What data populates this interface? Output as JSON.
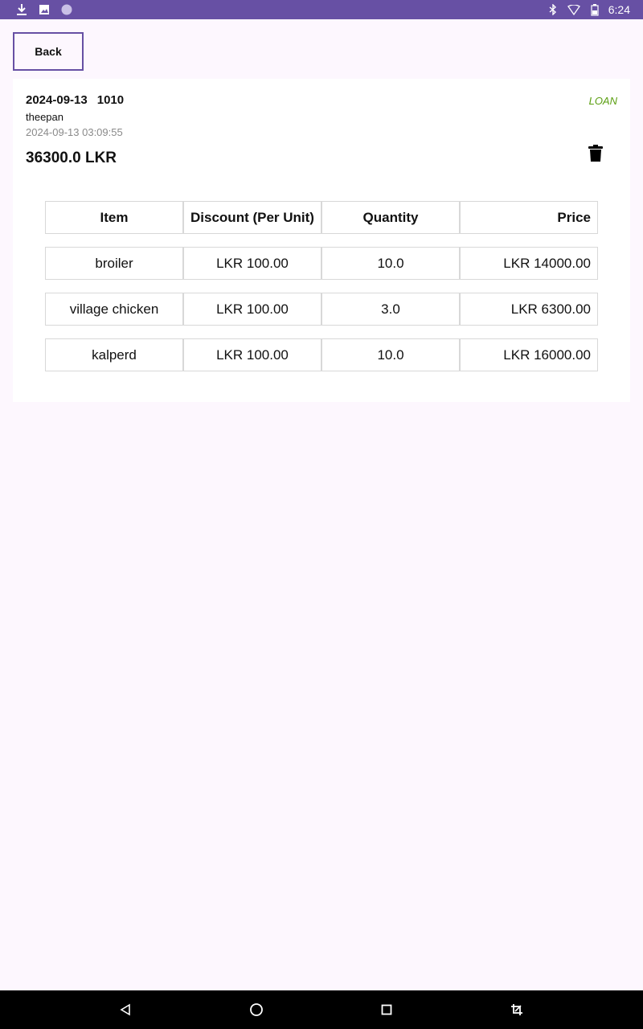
{
  "status_bar": {
    "time": "6:24",
    "left_icons": [
      "download-icon",
      "image-icon",
      "circle-icon"
    ],
    "right_icons": [
      "bluetooth-icon",
      "wifi-icon",
      "battery-icon"
    ]
  },
  "toolbar": {
    "back_label": "Back"
  },
  "order": {
    "date": "2024-09-13",
    "number": "1010",
    "customer": "theepan",
    "timestamp": "2024-09-13 03:09:55",
    "total": "36300.0 LKR",
    "status": "LOAN",
    "status_color": "#5a9e10"
  },
  "table": {
    "headers": {
      "item": "Item",
      "discount": "Discount (Per Unit)",
      "quantity": "Quantity",
      "price": "Price"
    },
    "rows": [
      {
        "item": "broiler",
        "discount": "LKR 100.00",
        "quantity": "10.0",
        "price": "LKR 14000.00"
      },
      {
        "item": "village chicken",
        "discount": "LKR 100.00",
        "quantity": "3.0",
        "price": "LKR 6300.00"
      },
      {
        "item": "kalperd",
        "discount": "LKR 100.00",
        "quantity": "10.0",
        "price": "LKR 16000.00"
      }
    ]
  },
  "nav_bar": {
    "icons": [
      "back-triangle-icon",
      "home-circle-icon",
      "recents-square-icon",
      "screenshot-crop-icon"
    ]
  },
  "colors": {
    "accent": "#6750a4",
    "background": "#fdf7fe"
  }
}
